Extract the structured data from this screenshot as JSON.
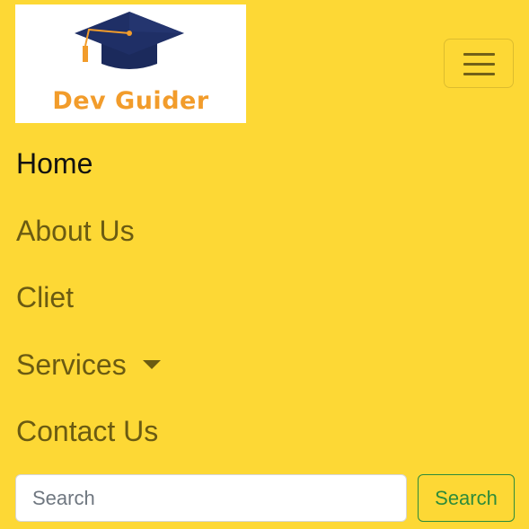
{
  "brand": {
    "name": "Dev Guider",
    "logo_icon": "graduation-cap-icon",
    "text_color": "#f29c2b",
    "cap_color": "#1b2a5c"
  },
  "navbar_toggler": {
    "icon": "hamburger-menu-icon"
  },
  "nav": {
    "items": [
      {
        "label": "Home",
        "active": true
      },
      {
        "label": "About Us"
      },
      {
        "label": "Cliet"
      },
      {
        "label": "Services",
        "dropdown": true
      },
      {
        "label": "Contact Us"
      }
    ]
  },
  "search": {
    "placeholder": "Search",
    "value": "",
    "button_label": "Search"
  },
  "colors": {
    "background": "#fdd835",
    "nav_text": "#6b5b12",
    "nav_active_text": "#111111",
    "search_button": "#2e8b3a"
  }
}
